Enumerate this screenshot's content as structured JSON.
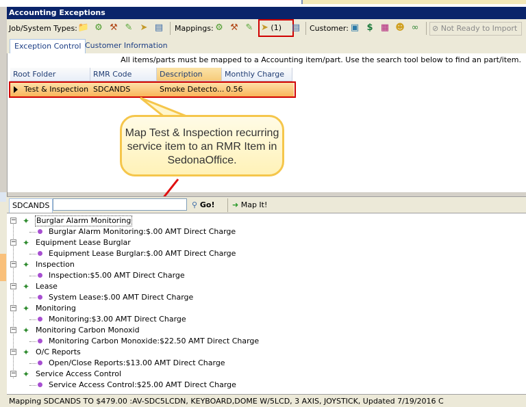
{
  "window": {
    "title": "Accounting Exceptions"
  },
  "toolbar": {
    "job_system_label": "Job/System Types:",
    "mappings_label": "Mappings:",
    "highlighted_count": "(1)",
    "customer_label": "Customer:",
    "not_ready_label": "Not Ready to Import"
  },
  "tabs": [
    {
      "label": "Exception Control",
      "active": true
    },
    {
      "label": "Customer Information",
      "active": false
    }
  ],
  "info_message": "All items/parts must be mapped to a Accounting item/part. Use the search tool below to find an part/item.",
  "grid": {
    "columns": [
      "Root Folder",
      "RMR Code",
      "Description",
      "Monthly Charge"
    ],
    "sorted_column": "Description",
    "rows": [
      {
        "root_folder": "Test & Inspection",
        "rmr_code": "SDCANDS",
        "description": "Smoke  Detecto...",
        "monthly_charge": "0.56"
      }
    ]
  },
  "callout": {
    "text": "Map Test & Inspection recurring service item to an RMR Item in SedonaOffice."
  },
  "search": {
    "label": "SDCANDS",
    "value": "",
    "placeholder": "",
    "go_label": "Go!",
    "mapit_label": "Map It!"
  },
  "tree": [
    {
      "category": "Burglar Alarm Monitoring",
      "item": "Burglar Alarm Monitoring:$.00 AMT Direct Charge"
    },
    {
      "category": "Equipment Lease Burglar",
      "item": "Equipment Lease Burglar:$.00 AMT Direct Charge"
    },
    {
      "category": "Inspection",
      "item": "Inspection:$5.00 AMT Direct Charge"
    },
    {
      "category": "Lease",
      "item": "System Lease:$.00 AMT Direct Charge"
    },
    {
      "category": "Monitoring",
      "item": "Monitoring:$3.00 AMT Direct Charge"
    },
    {
      "category": "Monitoring Carbon Monoxid",
      "item": "Monitoring Carbon Monoxide:$22.50 AMT Direct Charge"
    },
    {
      "category": "O/C Reports",
      "item": "Open/Close Reports:$13.00 AMT Direct Charge"
    },
    {
      "category": "Service Access Control",
      "item": "Service Access Control:$25.00 AMT Direct Charge"
    }
  ],
  "status_bar": "Mapping SDCANDS TO  $479.00 :AV-SDC5LCDN, KEYBOARD,DOME W/5LCD, 3 AXIS, JOYSTICK, Updated 7/19/2016  C",
  "colors": {
    "title_bar": "#0a246a",
    "highlight_row": "#f9b55a",
    "annotation_red": "#d00000",
    "callout_border": "#f5c64b"
  },
  "icons": {
    "job_system": [
      "folder-icon",
      "gear-icon",
      "tools-icon",
      "eraser-icon",
      "arrow-icon",
      "report-icon"
    ],
    "mappings": [
      "gear-icon",
      "tools-icon",
      "eraser-icon",
      "map-arrow-icon",
      "report-icon"
    ],
    "customer": [
      "building-icon",
      "dollar-icon",
      "grid-icon",
      "person-icon",
      "link-icon"
    ]
  }
}
